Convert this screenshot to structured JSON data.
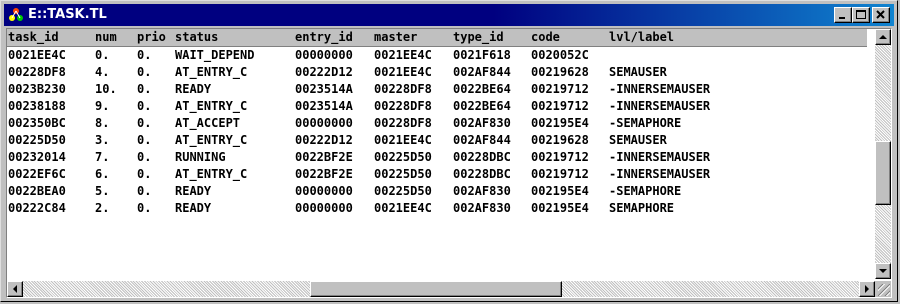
{
  "window": {
    "title": "E::TASK.TL",
    "icon": "cluster-icon"
  },
  "columns": [
    "task_id",
    "num",
    "prio",
    "status",
    "entry_id",
    "master",
    "type_id",
    "code",
    "lvl/label"
  ],
  "rows": [
    {
      "task_id": "0021EE4C",
      "num": "0.",
      "prio": "0.",
      "status": "WAIT_DEPEND",
      "entry_id": "00000000",
      "master": "0021EE4C",
      "type_id": "0021F618",
      "code": "0020052C",
      "label": ""
    },
    {
      "task_id": "00228DF8",
      "num": "4.",
      "prio": "0.",
      "status": "AT_ENTRY_C",
      "entry_id": "00222D12",
      "master": "0021EE4C",
      "type_id": "002AF844",
      "code": "00219628",
      "label": "SEMAUSER"
    },
    {
      "task_id": "0023B230",
      "num": "10.",
      "prio": "0.",
      "status": "READY",
      "entry_id": "0023514A",
      "master": "00228DF8",
      "type_id": "0022BE64",
      "code": "00219712",
      "label": "-INNERSEMAUSER"
    },
    {
      "task_id": "00238188",
      "num": "9.",
      "prio": "0.",
      "status": "AT_ENTRY_C",
      "entry_id": "0023514A",
      "master": "00228DF8",
      "type_id": "0022BE64",
      "code": "00219712",
      "label": "-INNERSEMAUSER"
    },
    {
      "task_id": "002350BC",
      "num": "8.",
      "prio": "0.",
      "status": "AT_ACCEPT",
      "entry_id": "00000000",
      "master": "00228DF8",
      "type_id": "002AF830",
      "code": "002195E4",
      "label": "-SEMAPHORE"
    },
    {
      "task_id": "00225D50",
      "num": "3.",
      "prio": "0.",
      "status": "AT_ENTRY_C",
      "entry_id": "00222D12",
      "master": "0021EE4C",
      "type_id": "002AF844",
      "code": "00219628",
      "label": "SEMAUSER"
    },
    {
      "task_id": "00232014",
      "num": "7.",
      "prio": "0.",
      "status": "RUNNING",
      "entry_id": "0022BF2E",
      "master": "00225D50",
      "type_id": "00228DBC",
      "code": "00219712",
      "label": "-INNERSEMAUSER"
    },
    {
      "task_id": "0022EF6C",
      "num": "6.",
      "prio": "0.",
      "status": "AT_ENTRY_C",
      "entry_id": "0022BF2E",
      "master": "00225D50",
      "type_id": "00228DBC",
      "code": "00219712",
      "label": "-INNERSEMAUSER"
    },
    {
      "task_id": "0022BEA0",
      "num": "5.",
      "prio": "0.",
      "status": "READY",
      "entry_id": "00000000",
      "master": "00225D50",
      "type_id": "002AF830",
      "code": "002195E4",
      "label": "-SEMAPHORE"
    },
    {
      "task_id": "00222C84",
      "num": "2.",
      "prio": "0.",
      "status": "READY",
      "entry_id": "00000000",
      "master": "0021EE4C",
      "type_id": "002AF830",
      "code": "002195E4",
      "label": "SEMAPHORE"
    }
  ],
  "colors": {
    "titlebar": "#000080",
    "titlebar_end": "#1084d0",
    "face": "#c0c0c0"
  }
}
